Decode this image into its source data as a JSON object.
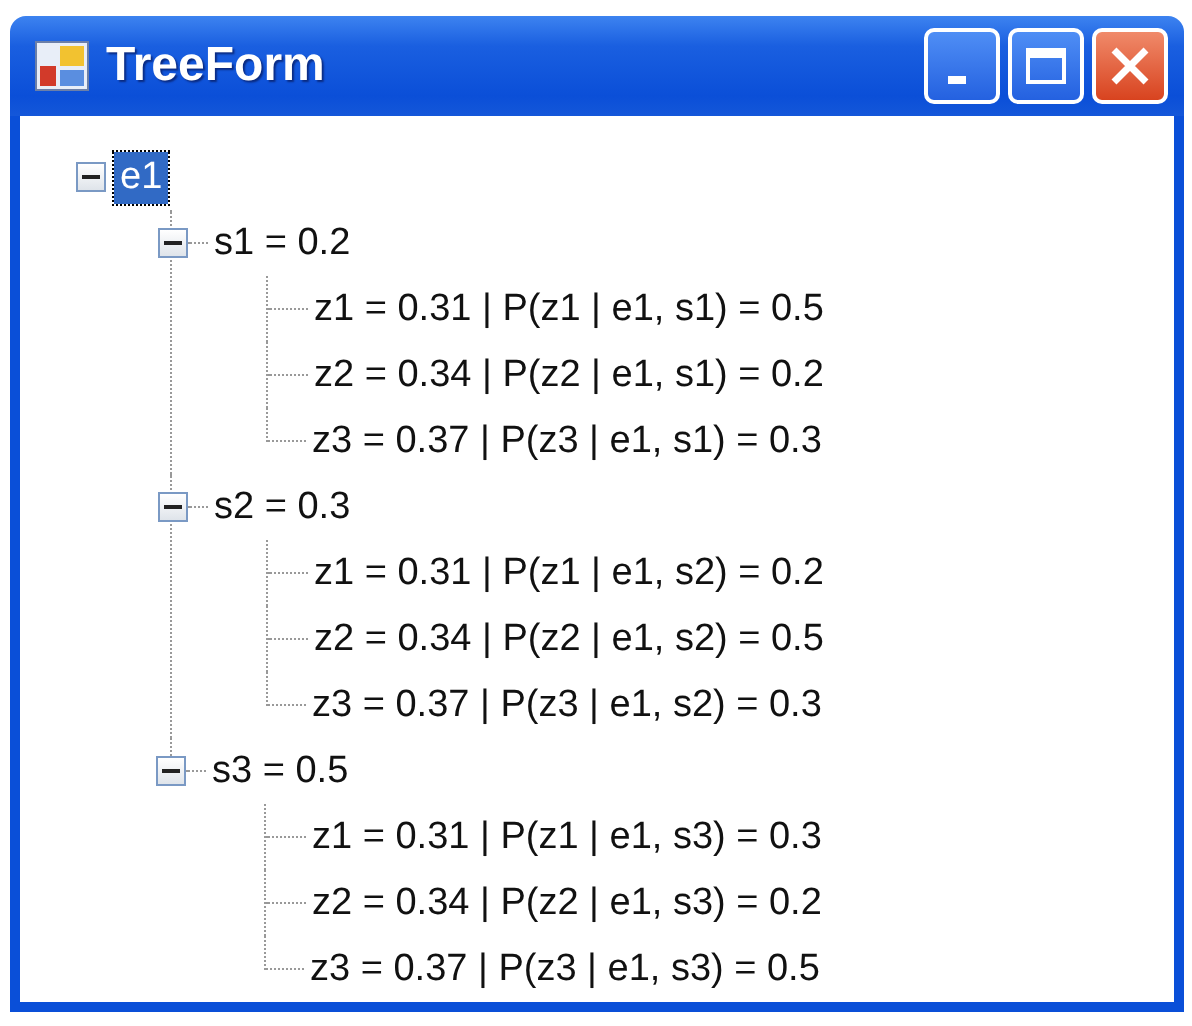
{
  "window": {
    "title": "TreeForm"
  },
  "tree": [
    {
      "label": "e1",
      "expanded": true,
      "selected": true,
      "children": [
        {
          "label": "s1 = 0.2",
          "expanded": true,
          "selected": false,
          "children": [
            {
              "label": "z1 = 0.31 | P(z1 | e1, s1) = 0.5",
              "selected": false
            },
            {
              "label": "z2 = 0.34 | P(z2 | e1, s1) = 0.2",
              "selected": false
            },
            {
              "label": "z3 = 0.37 | P(z3 | e1, s1) = 0.3",
              "selected": false
            }
          ]
        },
        {
          "label": "s2 = 0.3",
          "expanded": true,
          "selected": false,
          "children": [
            {
              "label": "z1 = 0.31 | P(z1 | e1, s2) = 0.2",
              "selected": false
            },
            {
              "label": "z2 = 0.34 | P(z2 | e1, s2) = 0.5",
              "selected": false
            },
            {
              "label": "z3 = 0.37 | P(z3 | e1, s2) = 0.3",
              "selected": false
            }
          ]
        },
        {
          "label": "s3 = 0.5",
          "expanded": true,
          "selected": false,
          "children": [
            {
              "label": "z1 = 0.31 | P(z1 | e1, s3) = 0.3",
              "selected": false
            },
            {
              "label": "z2 = 0.34 | P(z2 | e1, s3) = 0.2",
              "selected": false
            },
            {
              "label": "z3 = 0.37 | P(z3 | e1, s3) = 0.5",
              "selected": false
            }
          ]
        }
      ]
    }
  ]
}
